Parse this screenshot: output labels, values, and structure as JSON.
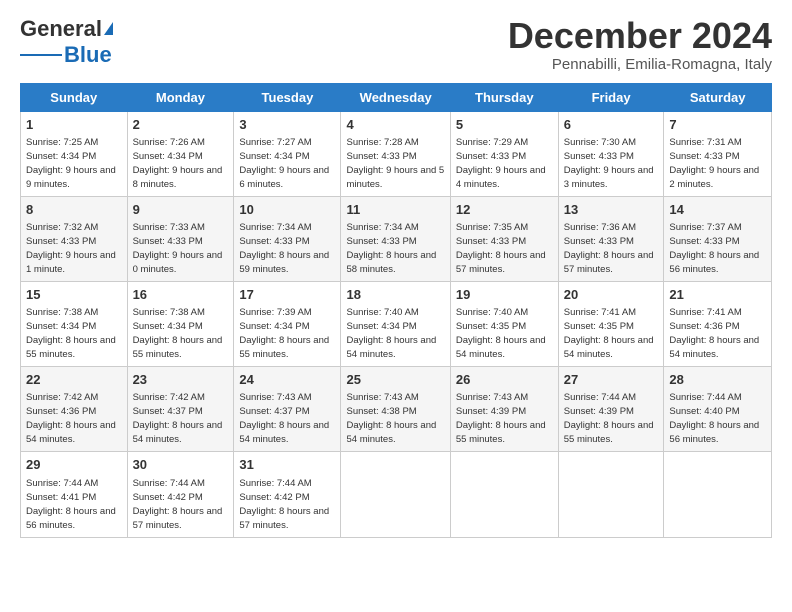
{
  "header": {
    "logo_main": "General",
    "logo_sub": "Blue",
    "month_title": "December 2024",
    "location": "Pennabilli, Emilia-Romagna, Italy"
  },
  "days_of_week": [
    "Sunday",
    "Monday",
    "Tuesday",
    "Wednesday",
    "Thursday",
    "Friday",
    "Saturday"
  ],
  "weeks": [
    [
      {
        "day": "1",
        "sunrise": "7:25 AM",
        "sunset": "4:34 PM",
        "daylight": "9 hours and 9 minutes."
      },
      {
        "day": "2",
        "sunrise": "7:26 AM",
        "sunset": "4:34 PM",
        "daylight": "9 hours and 8 minutes."
      },
      {
        "day": "3",
        "sunrise": "7:27 AM",
        "sunset": "4:34 PM",
        "daylight": "9 hours and 6 minutes."
      },
      {
        "day": "4",
        "sunrise": "7:28 AM",
        "sunset": "4:33 PM",
        "daylight": "9 hours and 5 minutes."
      },
      {
        "day": "5",
        "sunrise": "7:29 AM",
        "sunset": "4:33 PM",
        "daylight": "9 hours and 4 minutes."
      },
      {
        "day": "6",
        "sunrise": "7:30 AM",
        "sunset": "4:33 PM",
        "daylight": "9 hours and 3 minutes."
      },
      {
        "day": "7",
        "sunrise": "7:31 AM",
        "sunset": "4:33 PM",
        "daylight": "9 hours and 2 minutes."
      }
    ],
    [
      {
        "day": "8",
        "sunrise": "7:32 AM",
        "sunset": "4:33 PM",
        "daylight": "9 hours and 1 minute."
      },
      {
        "day": "9",
        "sunrise": "7:33 AM",
        "sunset": "4:33 PM",
        "daylight": "9 hours and 0 minutes."
      },
      {
        "day": "10",
        "sunrise": "7:34 AM",
        "sunset": "4:33 PM",
        "daylight": "8 hours and 59 minutes."
      },
      {
        "day": "11",
        "sunrise": "7:34 AM",
        "sunset": "4:33 PM",
        "daylight": "8 hours and 58 minutes."
      },
      {
        "day": "12",
        "sunrise": "7:35 AM",
        "sunset": "4:33 PM",
        "daylight": "8 hours and 57 minutes."
      },
      {
        "day": "13",
        "sunrise": "7:36 AM",
        "sunset": "4:33 PM",
        "daylight": "8 hours and 57 minutes."
      },
      {
        "day": "14",
        "sunrise": "7:37 AM",
        "sunset": "4:33 PM",
        "daylight": "8 hours and 56 minutes."
      }
    ],
    [
      {
        "day": "15",
        "sunrise": "7:38 AM",
        "sunset": "4:34 PM",
        "daylight": "8 hours and 55 minutes."
      },
      {
        "day": "16",
        "sunrise": "7:38 AM",
        "sunset": "4:34 PM",
        "daylight": "8 hours and 55 minutes."
      },
      {
        "day": "17",
        "sunrise": "7:39 AM",
        "sunset": "4:34 PM",
        "daylight": "8 hours and 55 minutes."
      },
      {
        "day": "18",
        "sunrise": "7:40 AM",
        "sunset": "4:34 PM",
        "daylight": "8 hours and 54 minutes."
      },
      {
        "day": "19",
        "sunrise": "7:40 AM",
        "sunset": "4:35 PM",
        "daylight": "8 hours and 54 minutes."
      },
      {
        "day": "20",
        "sunrise": "7:41 AM",
        "sunset": "4:35 PM",
        "daylight": "8 hours and 54 minutes."
      },
      {
        "day": "21",
        "sunrise": "7:41 AM",
        "sunset": "4:36 PM",
        "daylight": "8 hours and 54 minutes."
      }
    ],
    [
      {
        "day": "22",
        "sunrise": "7:42 AM",
        "sunset": "4:36 PM",
        "daylight": "8 hours and 54 minutes."
      },
      {
        "day": "23",
        "sunrise": "7:42 AM",
        "sunset": "4:37 PM",
        "daylight": "8 hours and 54 minutes."
      },
      {
        "day": "24",
        "sunrise": "7:43 AM",
        "sunset": "4:37 PM",
        "daylight": "8 hours and 54 minutes."
      },
      {
        "day": "25",
        "sunrise": "7:43 AM",
        "sunset": "4:38 PM",
        "daylight": "8 hours and 54 minutes."
      },
      {
        "day": "26",
        "sunrise": "7:43 AM",
        "sunset": "4:39 PM",
        "daylight": "8 hours and 55 minutes."
      },
      {
        "day": "27",
        "sunrise": "7:44 AM",
        "sunset": "4:39 PM",
        "daylight": "8 hours and 55 minutes."
      },
      {
        "day": "28",
        "sunrise": "7:44 AM",
        "sunset": "4:40 PM",
        "daylight": "8 hours and 56 minutes."
      }
    ],
    [
      {
        "day": "29",
        "sunrise": "7:44 AM",
        "sunset": "4:41 PM",
        "daylight": "8 hours and 56 minutes."
      },
      {
        "day": "30",
        "sunrise": "7:44 AM",
        "sunset": "4:42 PM",
        "daylight": "8 hours and 57 minutes."
      },
      {
        "day": "31",
        "sunrise": "7:44 AM",
        "sunset": "4:42 PM",
        "daylight": "8 hours and 57 minutes."
      },
      null,
      null,
      null,
      null
    ]
  ]
}
